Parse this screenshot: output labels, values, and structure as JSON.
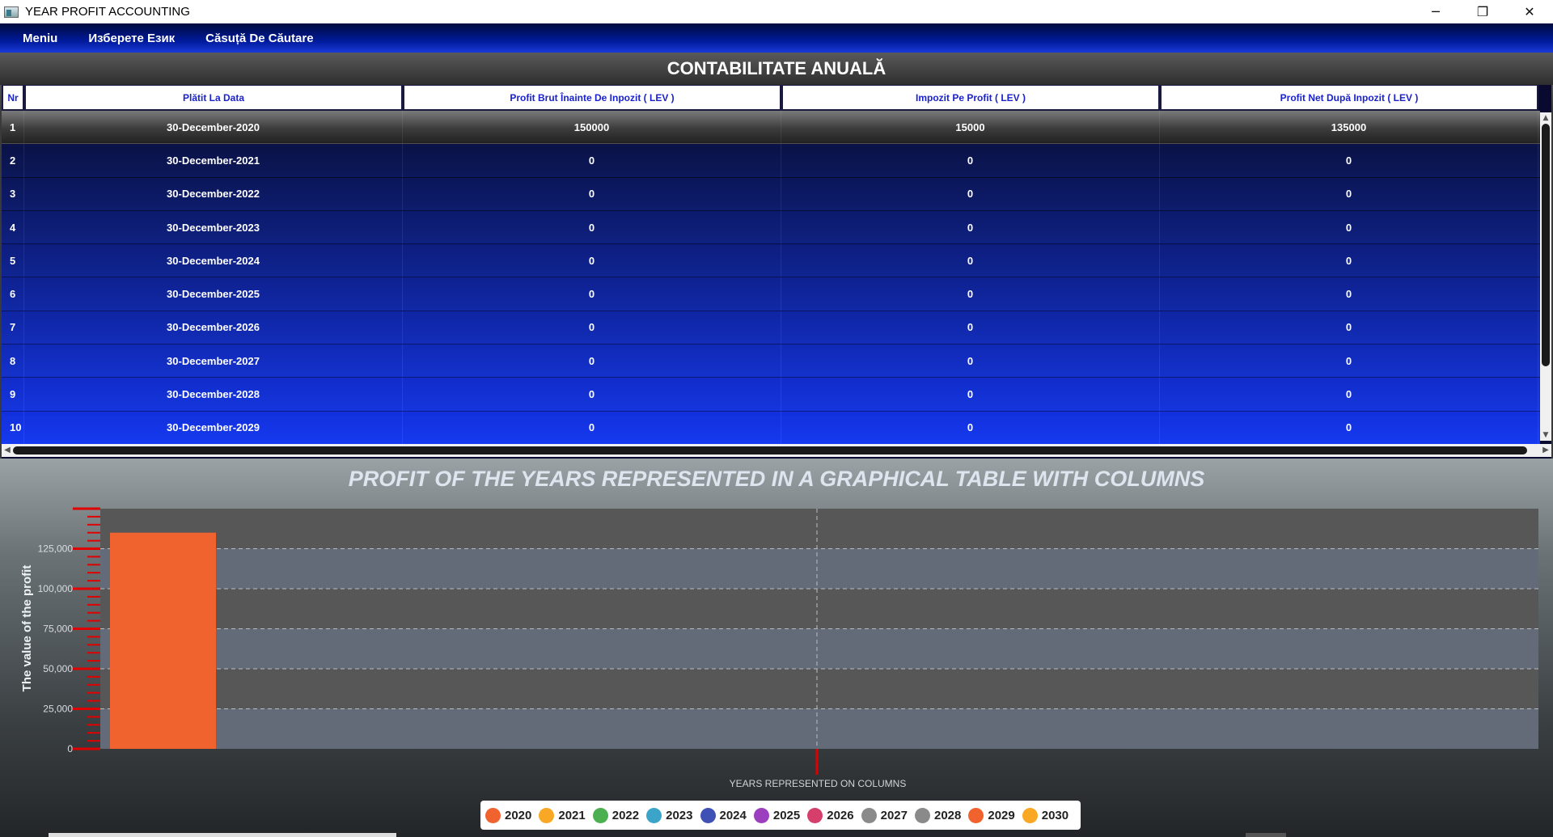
{
  "window": {
    "title": "YEAR PROFIT ACCOUNTING",
    "minimize_glyph": "─",
    "restore_glyph": "❐",
    "close_glyph": "✕"
  },
  "menu": {
    "items": [
      "Meniu",
      "Изберете Език",
      "Căsuță De Căutare"
    ]
  },
  "table": {
    "title": "CONTABILITATE ANUALĂ",
    "columns": [
      "Nr",
      "Plătit La Data",
      "Profit Brut Înainte De Inpozit ( LEV )",
      "Impozit Pe Profit ( LEV )",
      "Profit Net După Inpozit ( LEV )"
    ],
    "rows": [
      [
        "1",
        "30-December-2020",
        "150000",
        "15000",
        "135000"
      ],
      [
        "2",
        "30-December-2021",
        "0",
        "0",
        "0"
      ],
      [
        "3",
        "30-December-2022",
        "0",
        "0",
        "0"
      ],
      [
        "4",
        "30-December-2023",
        "0",
        "0",
        "0"
      ],
      [
        "5",
        "30-December-2024",
        "0",
        "0",
        "0"
      ],
      [
        "6",
        "30-December-2025",
        "0",
        "0",
        "0"
      ],
      [
        "7",
        "30-December-2026",
        "0",
        "0",
        "0"
      ],
      [
        "8",
        "30-December-2027",
        "0",
        "0",
        "0"
      ],
      [
        "9",
        "30-December-2028",
        "0",
        "0",
        "0"
      ],
      [
        "10",
        "30-December-2029",
        "0",
        "0",
        "0"
      ]
    ]
  },
  "chart": {
    "title": "PROFIT OF THE YEARS REPRESENTED IN A GRAPHICAL TABLE WITH COLUMNS"
  },
  "chart_data": {
    "type": "bar",
    "title": "PROFIT OF THE YEARS REPRESENTED IN A GRAPHICAL TABLE WITH COLUMNS",
    "xlabel": "YEARS REPRESENTED ON COLUMNS",
    "ylabel": "The value of the profit",
    "ylim": [
      0,
      150000
    ],
    "yticks": [
      0,
      25000,
      50000,
      75000,
      100000,
      125000
    ],
    "ytick_labels": [
      "0",
      "25,000",
      "50,000",
      "75,000",
      "100,000",
      "125,000"
    ],
    "grid": true,
    "legend_position": "bottom",
    "series": [
      {
        "name": "2020",
        "value": 135000,
        "color": "#f0622e"
      },
      {
        "name": "2021",
        "value": 0,
        "color": "#f9a825"
      },
      {
        "name": "2022",
        "value": 0,
        "color": "#4caf50"
      },
      {
        "name": "2023",
        "value": 0,
        "color": "#3ba4c8"
      },
      {
        "name": "2024",
        "value": 0,
        "color": "#3f51b5"
      },
      {
        "name": "2025",
        "value": 0,
        "color": "#9c3fbf"
      },
      {
        "name": "2026",
        "value": 0,
        "color": "#d63f6b"
      },
      {
        "name": "2027",
        "value": 0,
        "color": "#8a8a8a"
      },
      {
        "name": "2028",
        "value": 0,
        "color": "#8a8a8a"
      },
      {
        "name": "2029",
        "value": 0,
        "color": "#f0622e"
      },
      {
        "name": "2030",
        "value": 0,
        "color": "#f9a825"
      }
    ]
  },
  "colors": {
    "menubar_accent": "#001a9a",
    "header_text": "#1a22cc",
    "bar": "#f0622e",
    "axis_marks": "#e00000"
  }
}
